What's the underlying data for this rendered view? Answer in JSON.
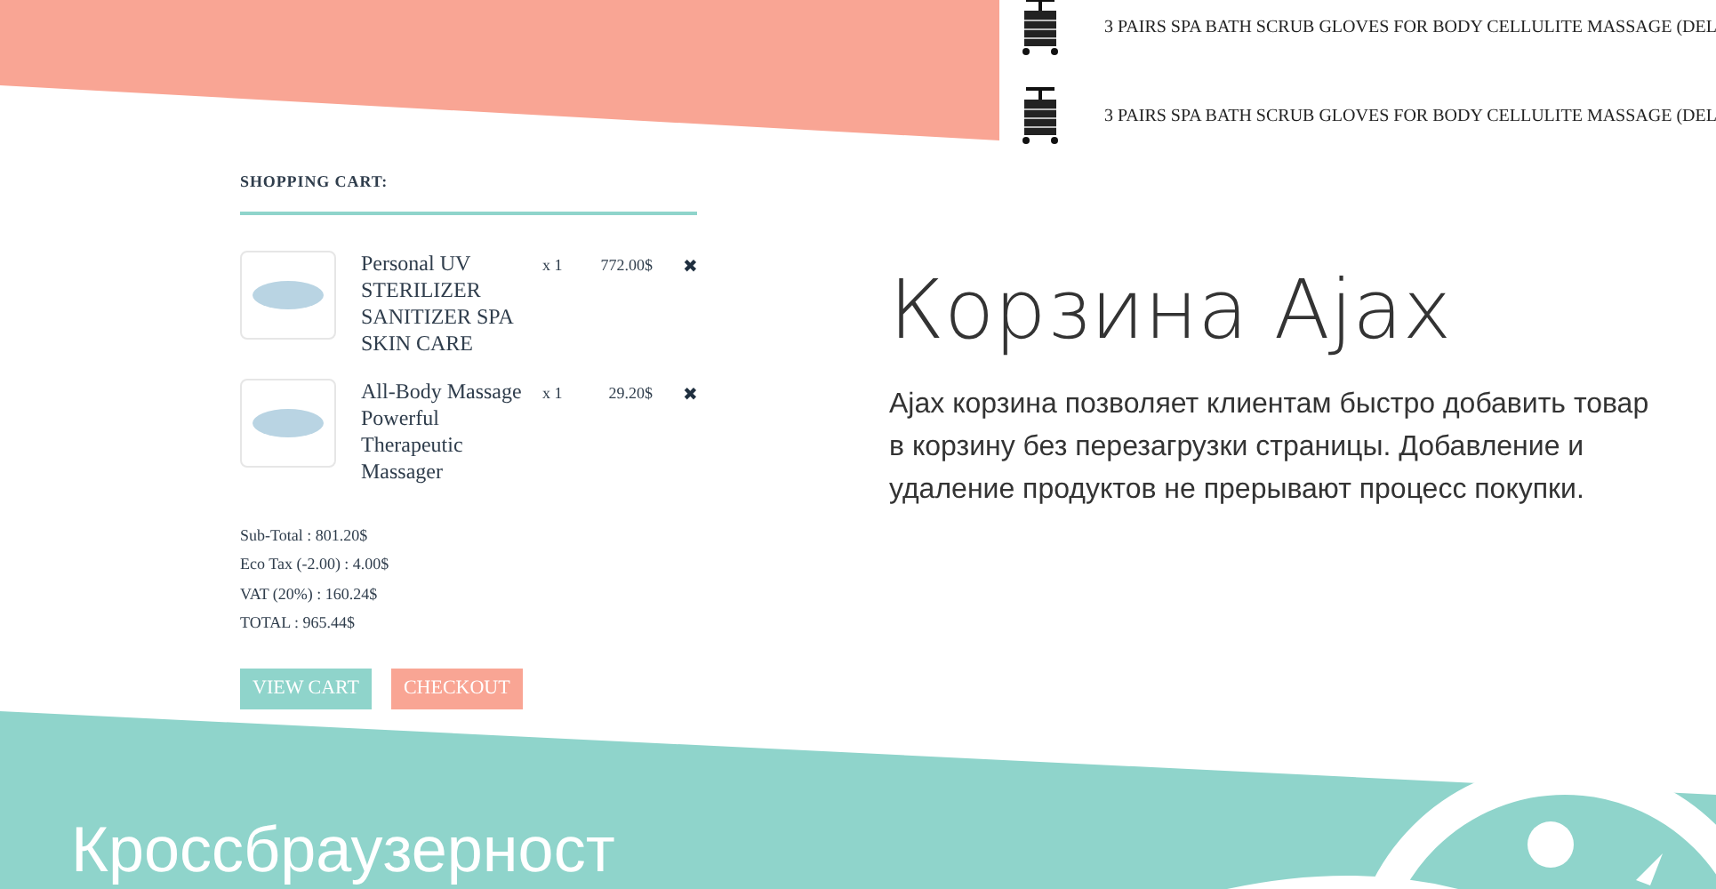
{
  "top_products": [
    {
      "name": "3 PAIRS SPA BATH SCRUB GLOVES FOR BODY CELLULITE MASSAGE (DEL"
    },
    {
      "name": "3 PAIRS SPA BATH SCRUB GLOVES FOR BODY CELLULITE MASSAGE (DEL"
    }
  ],
  "cart": {
    "title": "SHOPPING CART:",
    "items": [
      {
        "name": "Personal UV STERILIZER SANITIZER SPA SKIN CARE",
        "quantity": "x 1",
        "price": "772.00$",
        "remove": "✖"
      },
      {
        "name": "All-Body Massage Powerful Therapeutic Massager",
        "quantity": "x 1",
        "price": "29.20$",
        "remove": "✖"
      }
    ],
    "totals": [
      {
        "text": "Sub-Total : 801.20$"
      },
      {
        "text": "Eco Tax (-2.00) : 4.00$"
      },
      {
        "text": "VAT (20%) : 160.24$"
      },
      {
        "text": "TOTAL : 965.44$"
      }
    ],
    "buttons": [
      {
        "label": "VIEW CART",
        "kind": "secondary"
      },
      {
        "label": "CHECKOUT",
        "kind": "primary"
      }
    ]
  },
  "feature": {
    "title": "Корзина Ajax",
    "description": "Ajax корзина позволяет клиентам быстро добавить товар в корзину без перезагрузки страницы. Добавление и удаление продуктов не прерывают процесс покупки."
  },
  "next_section": {
    "title": "Кроссбраузерност"
  }
}
